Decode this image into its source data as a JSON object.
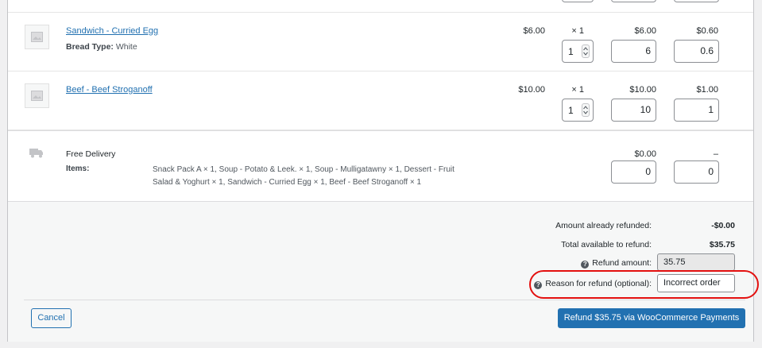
{
  "items": [
    {
      "name": "Sandwich - Curried Egg",
      "meta_key": "Bread Type:",
      "meta_value": "White",
      "cost": "$6.00",
      "qty_label": "× 1",
      "refund_qty": "1",
      "total": "$6.00",
      "refund_total": "6",
      "tax": "$0.60",
      "refund_tax": "0.6"
    },
    {
      "name": "Beef - Beef Stroganoff",
      "cost": "$10.00",
      "qty_label": "× 1",
      "refund_qty": "1",
      "total": "$10.00",
      "refund_total": "10",
      "tax": "$1.00",
      "refund_tax": "1"
    }
  ],
  "shipping": {
    "name": "Free Delivery",
    "items_label": "Items:",
    "items_value_line1": "Snack Pack A × 1, Soup - Potato & Leek. × 1, Soup - Mulligatawny × 1, Dessert - Fruit",
    "items_value_line2": "Salad & Yoghurt × 1, Sandwich - Curried Egg × 1, Beef - Beef Stroganoff × 1",
    "total": "$0.00",
    "refund_total": "0",
    "tax": "–",
    "refund_tax": "0"
  },
  "totals": {
    "already_refunded_label": "Amount already refunded:",
    "already_refunded_value": "-$0.00",
    "available_label": "Total available to refund:",
    "available_value": "$35.75",
    "refund_amount_label": "Refund amount:",
    "refund_amount_value": "35.75",
    "reason_label": "Reason for refund (optional):",
    "reason_value": "Incorrect order",
    "help_glyph": "?"
  },
  "actions": {
    "cancel_label": "Cancel",
    "refund_label": "Refund $35.75 via WooCommerce Payments"
  },
  "colors": {
    "link": "#2271b1",
    "primary_button": "#2271b1",
    "highlight": "#e3100f"
  },
  "icons": {
    "product_thumbnail": "image-placeholder-icon",
    "shipping": "truck-icon",
    "help": "help-icon",
    "stepper": "spinner-arrows-icon"
  }
}
